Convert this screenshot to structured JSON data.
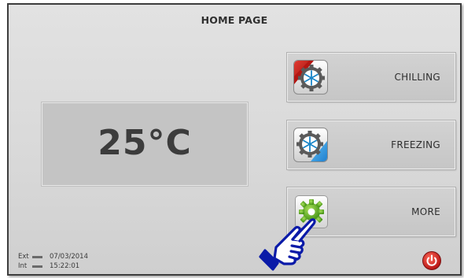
{
  "header": {
    "title": "HOME PAGE"
  },
  "temperature": {
    "value": "25°C"
  },
  "menu": {
    "chilling": {
      "label": "CHILLING",
      "icon": "chilling-gear-snowflake-icon",
      "accent": "#c8201c"
    },
    "freezing": {
      "label": "FREEZING",
      "icon": "freezing-gear-snowflake-icon",
      "accent": "#1e8fd6"
    },
    "more": {
      "label": "MORE",
      "icon": "green-gear-icon",
      "accent": "#5cae1e"
    }
  },
  "status": {
    "ext_label": "Ext",
    "ext_value": "07/03/2014",
    "int_label": "Int",
    "int_value": "15:22:01"
  },
  "power": {
    "icon": "power-icon",
    "color": "#d71f1f"
  },
  "pointer": {
    "icon": "pointing-hand-icon"
  }
}
